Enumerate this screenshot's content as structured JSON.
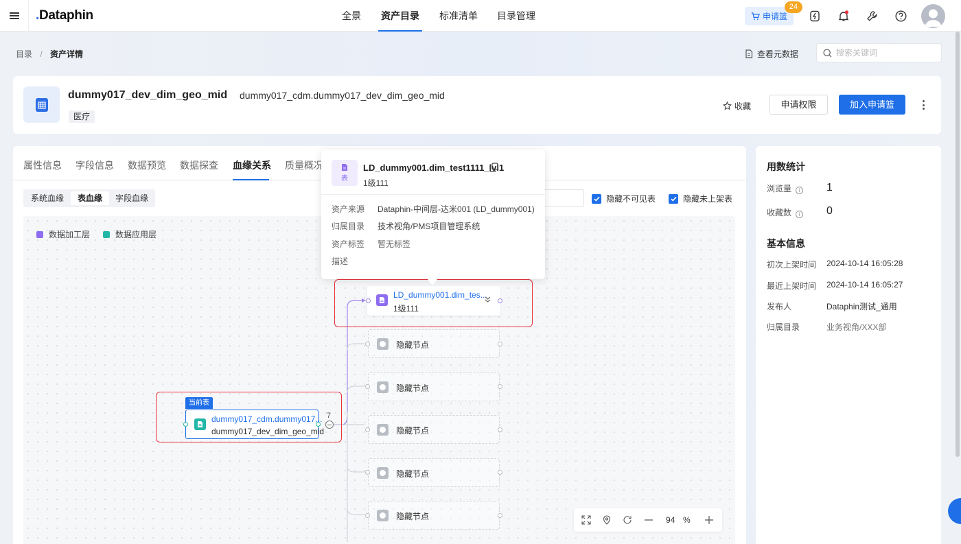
{
  "app": {
    "name": "Dataphin",
    "logo_dot": "."
  },
  "nav": [
    {
      "label": "全景"
    },
    {
      "label": "资产目录",
      "active": true
    },
    {
      "label": "标准清单"
    },
    {
      "label": "目录管理"
    }
  ],
  "header": {
    "cart_label": "申请篮",
    "cart_count": "24",
    "icons": [
      "bolt-icon",
      "bell-icon",
      "wrench-icon",
      "help-icon",
      "avatar"
    ]
  },
  "breadcrumb": {
    "root": "目录",
    "sep": "/",
    "current": "资产详情"
  },
  "toolbar": {
    "view_meta": "查看元数据",
    "search_placeholder": "搜索关键词"
  },
  "asset": {
    "name": "dummy017_dev_dim_geo_mid",
    "full_name": "dummy017_cdm.dummy017_dev_dim_geo_mid",
    "tag": "医疗",
    "favorite": "收藏",
    "apply_permission": "申请权限",
    "add_to_cart": "加入申请篮"
  },
  "tabs": [
    "属性信息",
    "字段信息",
    "数据预览",
    "数据探查",
    "血缘关系",
    "质量概况"
  ],
  "active_tab": "血缘关系",
  "lineage": {
    "modes": [
      "系统血缘",
      "表血缘",
      "字段血缘"
    ],
    "active_mode": "表血缘",
    "hide_invisible": "隐藏不可见表",
    "hide_unlisted": "隐藏未上架表",
    "legend": [
      {
        "label": "数据加工层",
        "color": "#8e6cf0"
      },
      {
        "label": "数据应用层",
        "color": "#22b7a6"
      }
    ],
    "current_tag": "当前表",
    "current_node": {
      "title": "dummy017_cdm.dummy017...",
      "subtitle": "dummy017_dev_dim_geo_mid"
    },
    "downstream_count": "7",
    "target_node": {
      "title": "LD_dummy001.dim_tes...",
      "subtitle": "1级111"
    },
    "hidden_label": "隐藏节点",
    "hidden_nodes": 5,
    "zoom_value": "94",
    "zoom_unit": "%"
  },
  "popover": {
    "icon_label": "表",
    "title": "LD_dummy001.dim_test1111_lvl1",
    "subtitle": "1级111",
    "rows": [
      {
        "k": "资产来源",
        "v": "Dataphin-中间层-达米001 (LD_dummy001)"
      },
      {
        "k": "归属目录",
        "v": "技术视角/PMS项目管理系统"
      },
      {
        "k": "资产标签",
        "v": "暂无标签"
      },
      {
        "k": "描述",
        "v": ""
      }
    ]
  },
  "stats": {
    "title": "用数统计",
    "views_label": "浏览量",
    "views": "1",
    "favs_label": "收藏数",
    "favs": "0"
  },
  "basic": {
    "title": "基本信息",
    "rows": [
      {
        "k": "初次上架时间",
        "v": "2024-10-14 16:05:28"
      },
      {
        "k": "最近上架时间",
        "v": "2024-10-14 16:05:27"
      },
      {
        "k": "发布人",
        "v": "Dataphin测试_通用"
      },
      {
        "k": "归属目录",
        "v": "业务视角/XXX部"
      }
    ]
  }
}
